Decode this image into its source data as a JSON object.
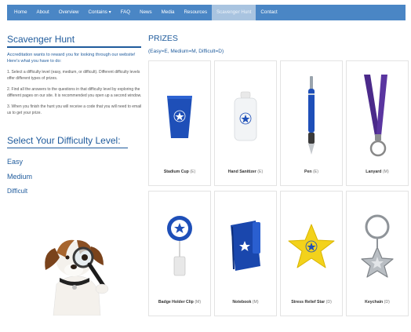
{
  "nav": {
    "items": [
      {
        "label": "Home"
      },
      {
        "label": "About"
      },
      {
        "label": "Overview"
      },
      {
        "label": "Contains ▾"
      },
      {
        "label": "FAQ"
      },
      {
        "label": "News"
      },
      {
        "label": "Media"
      },
      {
        "label": "Resources"
      },
      {
        "label": "Scavenger Hunt"
      },
      {
        "label": "Contact"
      }
    ],
    "active_index": 8,
    "colors": {
      "bar": "#4a86c5",
      "active": "#a9c4e0"
    }
  },
  "left": {
    "title": "Scavenger Hunt",
    "intro": "Accreditation wants to reward you for looking through our website! Here's what you have to do:",
    "steps": [
      "1. Select a difficulty level (easy, medium, or difficult). Different difficulty levels offer different types of prizes.",
      "2. Find all the answers to the questions in that difficulty level by exploring the different pages on our site. It is recommended you open up a second window.",
      "3. When you finish the hunt you will receive a code that you will need to email us to get your prize."
    ],
    "difficulty_title": "Select Your Difficulty Level:",
    "levels": [
      "Easy",
      "Medium",
      "Difficult"
    ]
  },
  "prizes": {
    "title": "PRIZES",
    "legend": "(Easy=E, Medium=M, Difficult=D)",
    "items": [
      {
        "name": "Stadium Cup",
        "level": "(E)",
        "icon": "stadium-cup-icon"
      },
      {
        "name": "Hand Sanitizer",
        "level": "(E)",
        "icon": "hand-sanitizer-icon"
      },
      {
        "name": "Pen",
        "level": "(E)",
        "icon": "pen-icon"
      },
      {
        "name": "Lanyard",
        "level": "(M)",
        "icon": "lanyard-icon"
      },
      {
        "name": "Badge Holder Clip",
        "level": "(M)",
        "icon": "badge-holder-clip-icon"
      },
      {
        "name": "Notebook",
        "level": "(M)",
        "icon": "notebook-icon"
      },
      {
        "name": "Stress Relief Star",
        "level": "(D)",
        "icon": "stress-star-icon"
      },
      {
        "name": "Keychain",
        "level": "(D)",
        "icon": "keychain-icon"
      }
    ]
  },
  "colors": {
    "brand_blue": "#1f5b9c",
    "product_blue": "#1e4fb8",
    "lanyard_purple": "#4b2a8a",
    "star_yellow": "#f3d21b"
  }
}
